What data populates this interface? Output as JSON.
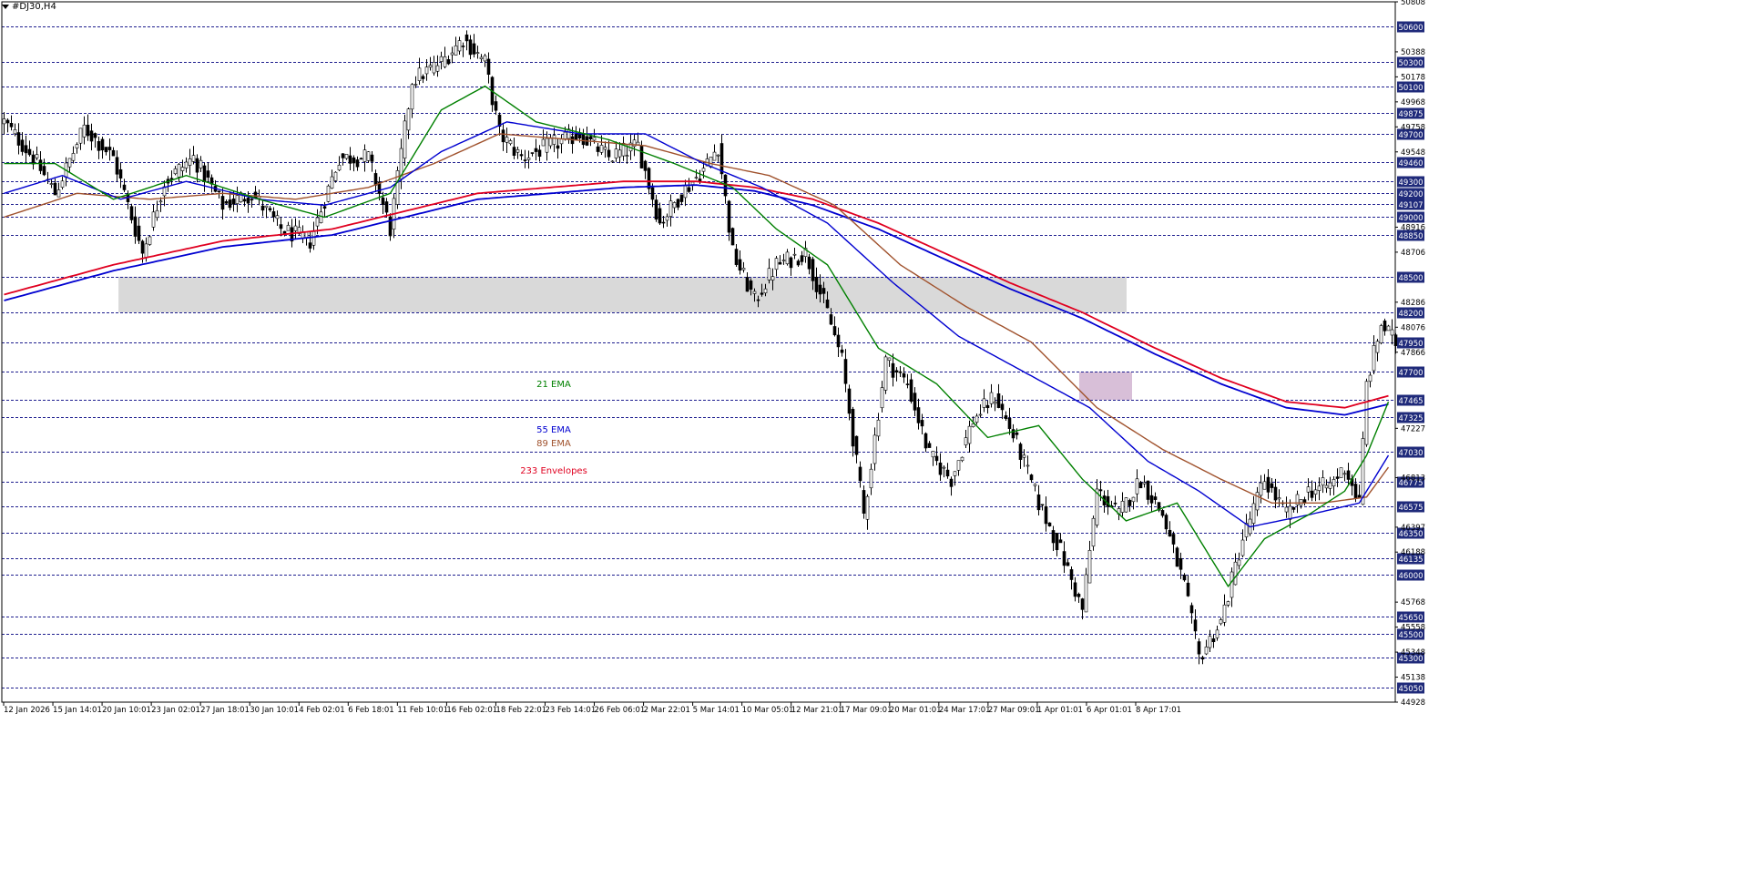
{
  "window": {
    "symbol_label": "#DJ30,H4"
  },
  "colors": {
    "ema21": "#008000",
    "ema55": "#0000d0",
    "ema89": "#a0522d",
    "env233": "#e00020",
    "grid": "#1f1f8f",
    "level_box_bg": "#1f2a7a",
    "zone_gray": "#d9d9d9",
    "zone_pink": "#d8bfd8"
  },
  "chart_data": {
    "type": "candlestick",
    "title": "#DJ30,H4",
    "ylim": [
      44928,
      50808
    ],
    "y_tick_labels": [
      50808,
      50388,
      50178,
      49968,
      49758,
      49548,
      48916,
      48706,
      48286,
      48076,
      47866,
      47227,
      46813,
      46397,
      46188,
      45768,
      45558,
      45348,
      45138,
      44928
    ],
    "level_lines": [
      50600,
      50300,
      50100,
      49875,
      49700,
      49460,
      49300,
      49200,
      49107,
      49000,
      48850,
      48500,
      48200,
      47950,
      47700,
      47465,
      47325,
      47030,
      46775,
      46575,
      46350,
      46135,
      46000,
      45650,
      45500,
      45300,
      45050
    ],
    "x_tick_labels": [
      "12 Jan 2026",
      "15 Jan 14:01",
      "20 Jan 10:01",
      "23 Jan 02:01",
      "27 Jan 18:01",
      "30 Jan 10:01",
      "4 Feb 02:01",
      "6 Feb 18:01",
      "11 Feb 10:01",
      "16 Feb 02:01",
      "18 Feb 22:01",
      "23 Feb 14:01",
      "26 Feb 06:01",
      "2 Mar 22:01",
      "5 Mar 14:01",
      "10 Mar 05:01",
      "12 Mar 21:01",
      "17 Mar 09:01",
      "20 Mar 01:01",
      "24 Mar 17:01",
      "27 Mar 09:01",
      "1 Apr 01:01",
      "6 Apr 01:01",
      "8 Apr 17:01"
    ],
    "zones": [
      {
        "name": "gray-zone",
        "from": 48200,
        "to": 48500,
        "x_start_label": "20 Jan 10:01",
        "x_end": "right edge"
      },
      {
        "name": "pink-zone",
        "from": 47465,
        "to": 47700,
        "x_start_label": "6 Apr 01:01",
        "x_end": "right edge"
      }
    ],
    "annotations": [
      {
        "text": "21 EMA",
        "color": "#008000"
      },
      {
        "text": "55 EMA",
        "color": "#0000d0"
      },
      {
        "text": "89 EMA",
        "color": "#a0522d"
      },
      {
        "text": "233 Envelopes",
        "color": "#e00020"
      }
    ],
    "candle_anchors": [
      {
        "i": 0,
        "p": 49800
      },
      {
        "i": 8,
        "p": 49500
      },
      {
        "i": 14,
        "p": 49200
      },
      {
        "i": 22,
        "p": 49750
      },
      {
        "i": 30,
        "p": 49500
      },
      {
        "i": 38,
        "p": 48700
      },
      {
        "i": 44,
        "p": 49300
      },
      {
        "i": 52,
        "p": 49500
      },
      {
        "i": 60,
        "p": 49100
      },
      {
        "i": 68,
        "p": 49200
      },
      {
        "i": 76,
        "p": 48900
      },
      {
        "i": 84,
        "p": 48800
      },
      {
        "i": 92,
        "p": 49500
      },
      {
        "i": 100,
        "p": 49500
      },
      {
        "i": 106,
        "p": 48900
      },
      {
        "i": 112,
        "p": 50150
      },
      {
        "i": 120,
        "p": 50300
      },
      {
        "i": 126,
        "p": 50500
      },
      {
        "i": 132,
        "p": 50300
      },
      {
        "i": 136,
        "p": 49700
      },
      {
        "i": 142,
        "p": 49500
      },
      {
        "i": 150,
        "p": 49600
      },
      {
        "i": 158,
        "p": 49700
      },
      {
        "i": 166,
        "p": 49500
      },
      {
        "i": 174,
        "p": 49600
      },
      {
        "i": 180,
        "p": 48950
      },
      {
        "i": 186,
        "p": 49200
      },
      {
        "i": 192,
        "p": 49400
      },
      {
        "i": 196,
        "p": 49600
      },
      {
        "i": 200,
        "p": 48700
      },
      {
        "i": 206,
        "p": 48300
      },
      {
        "i": 212,
        "p": 48600
      },
      {
        "i": 220,
        "p": 48700
      },
      {
        "i": 226,
        "p": 48200
      },
      {
        "i": 230,
        "p": 47800
      },
      {
        "i": 236,
        "p": 46500
      },
      {
        "i": 242,
        "p": 47800
      },
      {
        "i": 248,
        "p": 47600
      },
      {
        "i": 254,
        "p": 47000
      },
      {
        "i": 260,
        "p": 46800
      },
      {
        "i": 266,
        "p": 47300
      },
      {
        "i": 272,
        "p": 47500
      },
      {
        "i": 278,
        "p": 47100
      },
      {
        "i": 284,
        "p": 46600
      },
      {
        "i": 290,
        "p": 46200
      },
      {
        "i": 296,
        "p": 45700
      },
      {
        "i": 300,
        "p": 46700
      },
      {
        "i": 306,
        "p": 46500
      },
      {
        "i": 312,
        "p": 46800
      },
      {
        "i": 318,
        "p": 46500
      },
      {
        "i": 324,
        "p": 45900
      },
      {
        "i": 328,
        "p": 45300
      },
      {
        "i": 334,
        "p": 45600
      },
      {
        "i": 340,
        "p": 46300
      },
      {
        "i": 346,
        "p": 46800
      },
      {
        "i": 352,
        "p": 46500
      },
      {
        "i": 358,
        "p": 46700
      },
      {
        "i": 364,
        "p": 46750
      },
      {
        "i": 368,
        "p": 46900
      },
      {
        "i": 372,
        "p": 46600
      },
      {
        "i": 374,
        "p": 47600
      },
      {
        "i": 378,
        "p": 48100
      },
      {
        "i": 382,
        "p": 47950
      }
    ],
    "ema21": [
      {
        "i": 0,
        "p": 49450
      },
      {
        "i": 14,
        "p": 49450
      },
      {
        "i": 30,
        "p": 49150
      },
      {
        "i": 50,
        "p": 49350
      },
      {
        "i": 70,
        "p": 49150
      },
      {
        "i": 88,
        "p": 49000
      },
      {
        "i": 106,
        "p": 49200
      },
      {
        "i": 120,
        "p": 49900
      },
      {
        "i": 132,
        "p": 50100
      },
      {
        "i": 146,
        "p": 49800
      },
      {
        "i": 166,
        "p": 49650
      },
      {
        "i": 184,
        "p": 49450
      },
      {
        "i": 200,
        "p": 49250
      },
      {
        "i": 212,
        "p": 48900
      },
      {
        "i": 226,
        "p": 48600
      },
      {
        "i": 240,
        "p": 47900
      },
      {
        "i": 256,
        "p": 47600
      },
      {
        "i": 270,
        "p": 47150
      },
      {
        "i": 284,
        "p": 47250
      },
      {
        "i": 296,
        "p": 46800
      },
      {
        "i": 308,
        "p": 46450
      },
      {
        "i": 322,
        "p": 46600
      },
      {
        "i": 336,
        "p": 45900
      },
      {
        "i": 346,
        "p": 46300
      },
      {
        "i": 358,
        "p": 46500
      },
      {
        "i": 368,
        "p": 46700
      },
      {
        "i": 374,
        "p": 47000
      },
      {
        "i": 380,
        "p": 47450
      }
    ],
    "ema55": [
      {
        "i": 0,
        "p": 49200
      },
      {
        "i": 16,
        "p": 49350
      },
      {
        "i": 32,
        "p": 49150
      },
      {
        "i": 50,
        "p": 49300
      },
      {
        "i": 70,
        "p": 49150
      },
      {
        "i": 88,
        "p": 49100
      },
      {
        "i": 106,
        "p": 49250
      },
      {
        "i": 120,
        "p": 49550
      },
      {
        "i": 138,
        "p": 49800
      },
      {
        "i": 158,
        "p": 49700
      },
      {
        "i": 176,
        "p": 49700
      },
      {
        "i": 192,
        "p": 49450
      },
      {
        "i": 208,
        "p": 49250
      },
      {
        "i": 226,
        "p": 48950
      },
      {
        "i": 244,
        "p": 48450
      },
      {
        "i": 262,
        "p": 48000
      },
      {
        "i": 280,
        "p": 47700
      },
      {
        "i": 298,
        "p": 47400
      },
      {
        "i": 314,
        "p": 46950
      },
      {
        "i": 328,
        "p": 46700
      },
      {
        "i": 342,
        "p": 46400
      },
      {
        "i": 358,
        "p": 46500
      },
      {
        "i": 372,
        "p": 46600
      },
      {
        "i": 380,
        "p": 47000
      }
    ],
    "ema89": [
      {
        "i": 0,
        "p": 49000
      },
      {
        "i": 20,
        "p": 49200
      },
      {
        "i": 40,
        "p": 49150
      },
      {
        "i": 60,
        "p": 49200
      },
      {
        "i": 80,
        "p": 49150
      },
      {
        "i": 100,
        "p": 49250
      },
      {
        "i": 118,
        "p": 49450
      },
      {
        "i": 136,
        "p": 49700
      },
      {
        "i": 156,
        "p": 49650
      },
      {
        "i": 176,
        "p": 49600
      },
      {
        "i": 194,
        "p": 49450
      },
      {
        "i": 210,
        "p": 49350
      },
      {
        "i": 228,
        "p": 49100
      },
      {
        "i": 246,
        "p": 48600
      },
      {
        "i": 264,
        "p": 48250
      },
      {
        "i": 282,
        "p": 47950
      },
      {
        "i": 300,
        "p": 47400
      },
      {
        "i": 318,
        "p": 47050
      },
      {
        "i": 334,
        "p": 46800
      },
      {
        "i": 348,
        "p": 46600
      },
      {
        "i": 362,
        "p": 46600
      },
      {
        "i": 374,
        "p": 46650
      },
      {
        "i": 380,
        "p": 46900
      }
    ],
    "env233_upper": [
      {
        "i": 0,
        "p": 48350
      },
      {
        "i": 30,
        "p": 48600
      },
      {
        "i": 60,
        "p": 48800
      },
      {
        "i": 90,
        "p": 48900
      },
      {
        "i": 110,
        "p": 49050
      },
      {
        "i": 130,
        "p": 49200
      },
      {
        "i": 150,
        "p": 49250
      },
      {
        "i": 170,
        "p": 49300
      },
      {
        "i": 190,
        "p": 49300
      },
      {
        "i": 206,
        "p": 49250
      },
      {
        "i": 222,
        "p": 49150
      },
      {
        "i": 240,
        "p": 48950
      },
      {
        "i": 258,
        "p": 48700
      },
      {
        "i": 276,
        "p": 48450
      },
      {
        "i": 296,
        "p": 48200
      },
      {
        "i": 316,
        "p": 47900
      },
      {
        "i": 334,
        "p": 47650
      },
      {
        "i": 352,
        "p": 47450
      },
      {
        "i": 368,
        "p": 47400
      },
      {
        "i": 380,
        "p": 47500
      }
    ],
    "env233_lower": [
      {
        "i": 0,
        "p": 48300
      },
      {
        "i": 30,
        "p": 48550
      },
      {
        "i": 60,
        "p": 48750
      },
      {
        "i": 90,
        "p": 48850
      },
      {
        "i": 110,
        "p": 49000
      },
      {
        "i": 130,
        "p": 49150
      },
      {
        "i": 150,
        "p": 49200
      },
      {
        "i": 170,
        "p": 49250
      },
      {
        "i": 190,
        "p": 49270
      },
      {
        "i": 206,
        "p": 49220
      },
      {
        "i": 222,
        "p": 49100
      },
      {
        "i": 240,
        "p": 48900
      },
      {
        "i": 258,
        "p": 48650
      },
      {
        "i": 276,
        "p": 48400
      },
      {
        "i": 296,
        "p": 48150
      },
      {
        "i": 316,
        "p": 47850
      },
      {
        "i": 334,
        "p": 47600
      },
      {
        "i": 352,
        "p": 47400
      },
      {
        "i": 368,
        "p": 47340
      },
      {
        "i": 380,
        "p": 47430
      }
    ]
  }
}
